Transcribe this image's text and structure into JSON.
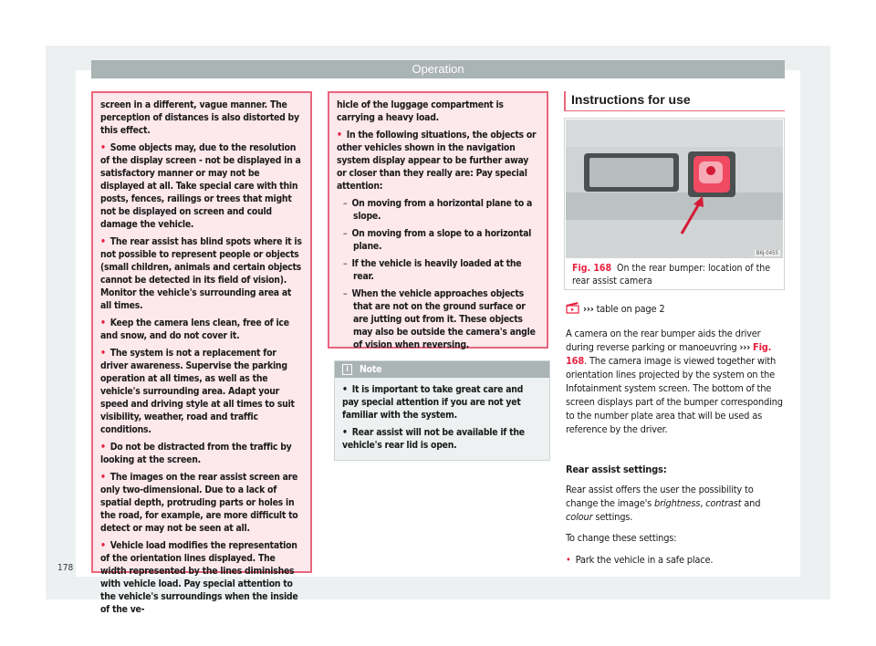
{
  "header": {
    "title": "Operation"
  },
  "page_number": "178",
  "column1": {
    "paragraphs": [
      {
        "bullet": false,
        "text": "screen in a different, vague manner. The perception of distances is also distorted by this effect."
      },
      {
        "bullet": true,
        "text": "Some objects may, due to the resolution of the display screen - not be displayed in a satisfactory manner or may not be displayed at all. Take special care with thin posts, fences, railings or trees that might not be displayed on screen and could damage the vehicle."
      },
      {
        "bullet": true,
        "text": "The rear assist has blind spots where it is not possible to represent people or objects (small children, animals and certain objects cannot be detected in its field of vision). Monitor the vehicle's surrounding area at all times."
      },
      {
        "bullet": true,
        "text": "Keep the camera lens clean, free of ice and snow, and do not cover it."
      },
      {
        "bullet": true,
        "text": "The system is not a replacement for driver awareness. Supervise the parking operation at all times, as well as the vehicle's surrounding area. Adapt your speed and driving style at all times to suit visibility, weather, road and traffic conditions."
      },
      {
        "bullet": true,
        "text": "Do not be distracted from the traffic by looking at the screen."
      },
      {
        "bullet": true,
        "text": "The images on the rear assist screen are only two-dimensional. Due to a lack of spatial depth, protruding parts or holes in the road, for example, are more difficult to detect or may not be seen at all."
      },
      {
        "bullet": true,
        "text": "Vehicle load modifies the representation of the orientation lines displayed. The width represented by the lines diminishes with vehicle load. Pay special attention to the vehicle's surroundings when the inside of the ve-"
      }
    ]
  },
  "column2": {
    "warning": {
      "continuation": "hicle of the luggage compartment is carrying a heavy load.",
      "bullet": "In the following situations, the objects or other vehicles shown in the navigation system display appear to be further away or closer than they really are: Pay special attention:",
      "dashes": [
        "On moving from a horizontal plane to a slope.",
        "On moving from a slope to a horizontal plane.",
        "If the vehicle is heavily loaded at the rear.",
        "When the vehicle approaches objects that are not on the ground surface or are jutting out from it. These objects may also be outside the camera's angle of vision when reversing."
      ]
    },
    "note": {
      "title": "Note",
      "icon": "info-icon",
      "items": [
        "It is important to take great care and pay special attention if you are not yet familiar with the system.",
        "Rear assist will not be available if the vehicle's rear lid is open."
      ]
    }
  },
  "column3": {
    "section_title": "Instructions for use",
    "figure": {
      "code": "B6J-0455",
      "label": "Fig. 168",
      "caption": "On the rear bumper: location of the rear assist camera"
    },
    "table_link": {
      "icon": "video-clapper-icon",
      "arrows": "›››",
      "text": "table on page 2"
    },
    "intro": {
      "before": "A camera on the rear bumper aids the driver during reverse parking or manoeuvring ",
      "arrows": "›››",
      "fig_ref": "Fig. 168",
      "after": ". The camera image is viewed together with orientation lines projected by the system on the Infotainment system screen. The bottom of the screen displays part of the bumper corresponding to the number plate area that will be used as reference by the driver."
    },
    "settings_heading": "Rear assist settings:",
    "settings_text": {
      "before": "Rear assist offers the user the possibility to change the image's ",
      "brightness": "brightness",
      "comma": ", ",
      "contrast": "contrast",
      "and": " and ",
      "colour": "colour",
      "after": " settings."
    },
    "change_intro": "To change these settings:",
    "steps": [
      "Park the vehicle in a safe place."
    ]
  },
  "colors": {
    "accent": "#e8203f",
    "warning_border": "#e9667d",
    "warning_bg": "#fde8ec",
    "header_bar": "#a9b4b3",
    "frame": "#edf0f1"
  }
}
